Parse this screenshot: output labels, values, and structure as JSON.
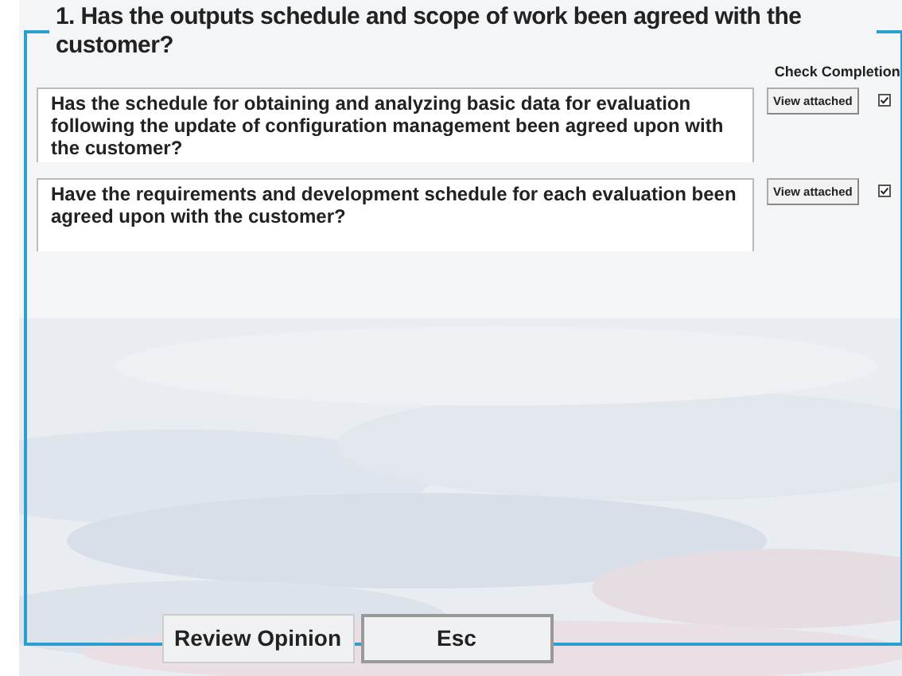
{
  "title": "1. Has the outputs schedule and scope of work been agreed with the customer?",
  "completion_header": "Check Completion",
  "questions": [
    {
      "text": "Has the schedule for obtaining and analyzing basic data for evaluation following the update of configuration management been agreed upon with the customer?",
      "attach_label": "View attached",
      "checked": true
    },
    {
      "text": "Have the requirements and development schedule for each evaluation been agreed upon with the customer?",
      "attach_label": "View attached",
      "checked": true
    }
  ],
  "buttons": [
    {
      "label": "Review Opinion",
      "kind": "flat"
    },
    {
      "label": "Esc",
      "kind": "framed"
    }
  ]
}
